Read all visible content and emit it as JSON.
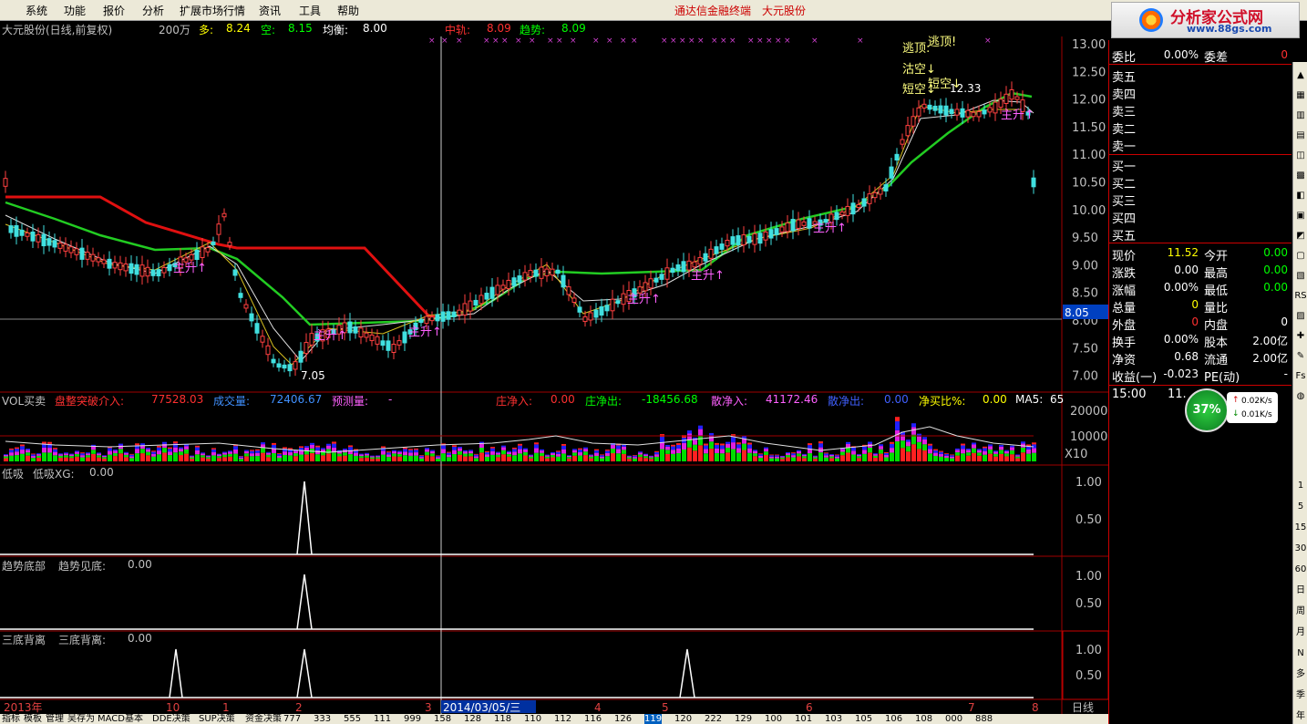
{
  "menu": {
    "items": [
      "系统",
      "功能",
      "报价",
      "分析",
      "扩展市场行情",
      "资讯",
      "工具",
      "帮助"
    ],
    "title_app": "通达信金融终端",
    "title_stock": "大元股份"
  },
  "logo": {
    "main": "分析家公式网",
    "sub": "www.88gs.com"
  },
  "main_chart": {
    "header": {
      "name": "大元股份(日线,前复权)",
      "vol_unit": "200万",
      "duo_label": "多:",
      "duo_val": "8.24",
      "kong_label": "空:",
      "kong_val": "8.15",
      "junheng_label": "均衡:",
      "junheng_val": "8.00",
      "zhonggui_label": "中轨:",
      "zhonggui_val": "8.09",
      "qushi_label": "趋势:",
      "qushi_val": "8.09"
    },
    "y_ticks": [
      "13.00",
      "12.50",
      "12.00",
      "11.50",
      "11.00",
      "10.50",
      "10.00",
      "9.50",
      "9.00",
      "8.50",
      "8.00",
      "7.50",
      "7.00"
    ],
    "current_price_tag": "8.05",
    "annotations": {
      "low": "7.05",
      "high": "12.33",
      "taoding": "逃顶:",
      "taoding2": "逃顶!",
      "gukong": "沽空↓",
      "duankong": "短空↓",
      "duankong2": "短空↓",
      "zhusheng": "主升↑"
    }
  },
  "vol_panel": {
    "title": "VOL买卖",
    "pzbt_label": "盘整突破介入:",
    "pzbt_val": "77528.03",
    "cjl_label": "成交量:",
    "cjl_val": "72406.67",
    "ycl_label": "预测量:",
    "ycl_val": "-",
    "zjr_label": "庄净入:",
    "zjr_val": "0.00",
    "zjc_label": "庄净出:",
    "zjc_val": "-18456.68",
    "sjr_label": "散净入:",
    "sjr_val": "41172.46",
    "sjc_label": "散净出:",
    "sjc_val": "0.00",
    "jmb_label": "净买比%:",
    "jmb_val": "0.00",
    "ma5_label": "MA5:",
    "ma5_val": "65",
    "y_ticks": [
      "20000",
      "10000"
    ],
    "x_unit": "X10"
  },
  "panels": [
    {
      "title": "低吸",
      "sub": "低吸XG:",
      "val": "0.00",
      "ticks": [
        "1.00",
        "0.50"
      ]
    },
    {
      "title": "趋势底部",
      "sub": "趋势见底:",
      "val": "0.00",
      "ticks": [
        "1.00",
        "0.50"
      ]
    },
    {
      "title": "三底背离",
      "sub": "三底背离:",
      "val": "0.00",
      "ticks": [
        "1.00",
        "0.50"
      ]
    }
  ],
  "x_axis": {
    "year": "2013年",
    "months": [
      "10",
      "1",
      "2",
      "3",
      "4",
      "5",
      "6",
      "7",
      "8"
    ],
    "cursor_date": "2014/03/05/三",
    "period": "日线"
  },
  "right_panel": {
    "weibi_label": "委比",
    "weibi_val": "0.00%",
    "weicha_label": "委差",
    "weicha_val": "0",
    "sell": [
      "卖五",
      "卖四",
      "卖三",
      "卖二",
      "卖一"
    ],
    "buy": [
      "买一",
      "买二",
      "买三",
      "买四",
      "买五"
    ],
    "rows": [
      {
        "l": "现价",
        "v": "11.52",
        "l2": "今开",
        "v2": "0.00"
      },
      {
        "l": "涨跌",
        "v": "0.00",
        "l2": "最高",
        "v2": "0.00"
      },
      {
        "l": "涨幅",
        "v": "0.00%",
        "l2": "最低",
        "v2": "0.00"
      },
      {
        "l": "总量",
        "v": "0",
        "l2": "量比",
        "v2": ""
      },
      {
        "l": "外盘",
        "v": "0",
        "l2": "内盘",
        "v2": "0"
      },
      {
        "l": "换手",
        "v": "0.00%",
        "l2": "股本",
        "v2": "2.00亿"
      },
      {
        "l": "净资",
        "v": "0.68",
        "l2": "流通",
        "v2": "2.00亿"
      },
      {
        "l": "收益(一)",
        "v": "-0.023",
        "l2": "PE(动)",
        "v2": "-"
      }
    ],
    "time": "15:00",
    "time_val": "11."
  },
  "speed": {
    "pct": "37%",
    "up": "0.02K/s",
    "down": "0.01K/s"
  },
  "toolbar": {
    "labels": [
      "1",
      "5",
      "15",
      "30",
      "60",
      "日",
      "周",
      "月",
      "N",
      "多",
      "季",
      "年"
    ]
  },
  "bottom_tabs": [
    "指标",
    "模板",
    "管理",
    "吴存为",
    "MACD基本",
    "DDE决策",
    "SUP决策",
    "资金决策",
    "777",
    "333",
    "555",
    "111",
    "999",
    "158",
    "128",
    "118",
    "110",
    "112",
    "116",
    "126",
    "119",
    "120",
    "222",
    "129",
    "100",
    "101",
    "103",
    "105",
    "106",
    "108",
    "000",
    "888"
  ]
}
